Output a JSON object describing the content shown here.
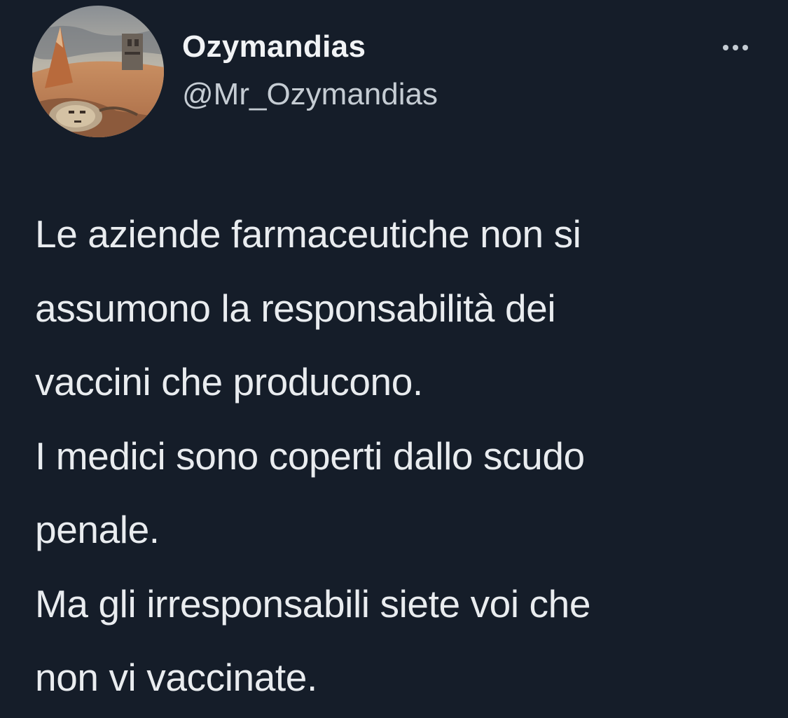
{
  "tweet": {
    "author": {
      "display_name": "Ozymandias",
      "handle": "@Mr_Ozymandias",
      "avatar_icon": "avatar-painting-desert-ruins"
    },
    "more_icon": "more-horizontal-icon",
    "body_lines": [
      "Le aziende farmaceutiche non si",
      "assumono la responsabilità dei",
      "vaccini che producono.",
      "I medici sono coperti dallo scudo",
      "penale.",
      "Ma gli irresponsabili siete voi che",
      "non vi vaccinate."
    ]
  },
  "colors": {
    "background": "#151d29",
    "text_primary": "#e9ecef",
    "text_secondary": "#c5ccd3"
  }
}
